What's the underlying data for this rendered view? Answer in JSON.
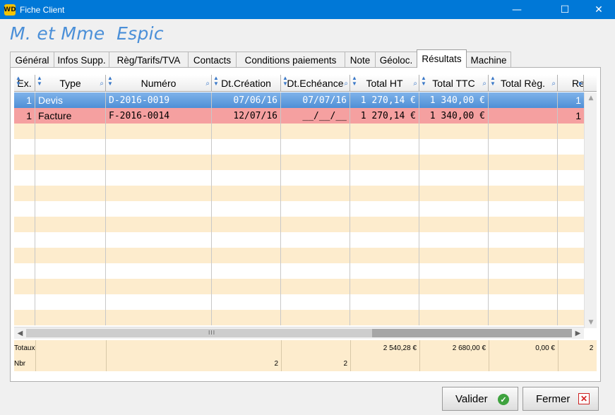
{
  "window": {
    "icon_label": "WD",
    "title": "Fiche Client",
    "minimize_glyph": "—",
    "maximize_glyph": "☐",
    "close_glyph": "✕"
  },
  "client_name": "M. et Mme  Espic",
  "tabs": [
    {
      "label": "Général",
      "active": false
    },
    {
      "label": "Infos Supp.",
      "active": false
    },
    {
      "label": "Règ/Tarifs/TVA",
      "active": false
    },
    {
      "label": "Contacts",
      "active": false
    },
    {
      "label": "Conditions paiements",
      "active": false
    },
    {
      "label": "Note",
      "active": false
    },
    {
      "label": "Géoloc.",
      "active": false
    },
    {
      "label": "Résultats",
      "active": true
    },
    {
      "label": "Machine",
      "active": false
    }
  ],
  "grid": {
    "columns": [
      {
        "label": "Ex."
      },
      {
        "label": "Type"
      },
      {
        "label": "Numéro"
      },
      {
        "label": "Dt.Création"
      },
      {
        "label": "Dt.Echéance"
      },
      {
        "label": "Total HT"
      },
      {
        "label": "Total TTC"
      },
      {
        "label": "Total Règ."
      },
      {
        "label": "Re"
      }
    ],
    "rows": [
      {
        "style": "sel-blue",
        "cells": [
          "1",
          "Devis",
          "D-2016-0019",
          "07/06/16",
          "07/07/16",
          "1 270,14 €",
          "1 340,00 €",
          "",
          "1"
        ]
      },
      {
        "style": "sel-red",
        "cells": [
          "1",
          "Facture",
          "F-2016-0014",
          "12/07/16",
          "__/__/__",
          "1 270,14 €",
          "1 340,00 €",
          "",
          "1"
        ]
      }
    ],
    "empty_row_count": 13
  },
  "totals": {
    "totaux_label": "Totaux",
    "nbr_label": "Nbr",
    "total_ht": "2 540,28 €",
    "total_ttc": "2 680,00 €",
    "total_reg": "0,00 €",
    "re": "2",
    "nbr_creation": "2",
    "nbr_echeance": "2"
  },
  "buttons": {
    "validate_label": "Valider",
    "close_label": "Fermer"
  },
  "icons": {
    "sort": "sort-arrows-icon",
    "search": "magnifier-icon",
    "ok": "check-circle-icon",
    "close": "close-x-icon"
  },
  "colors": {
    "titlebar": "#0078d7",
    "client_name": "#4a8fd8",
    "row_selected_blue": "#4f8fd6",
    "row_selected_red": "#f5a0a0",
    "row_stripe": "#fdeccd"
  }
}
